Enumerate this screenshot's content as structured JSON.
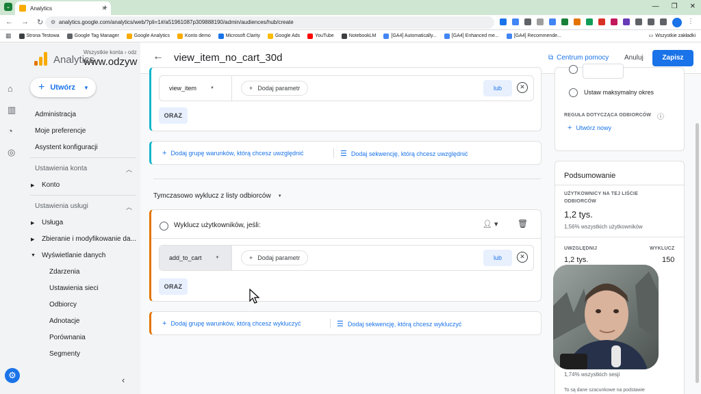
{
  "browser": {
    "tab_title": "Analytics",
    "url": "analytics.google.com/analytics/web/?pli=1#/a51961087p309888190/admin/audiences/hub/create",
    "bookmarks": [
      {
        "label": "Strona Testowa",
        "color": "#3c4043"
      },
      {
        "label": "Google Tag Manager",
        "color": "#5f6368"
      },
      {
        "label": "Google Analytics",
        "color": "#f9ab00"
      },
      {
        "label": "Konto demo",
        "color": "#f9ab00"
      },
      {
        "label": "Microsoft Clarity",
        "color": "#1a73e8"
      },
      {
        "label": "Google Ads",
        "color": "#fbbc04"
      },
      {
        "label": "YouTube",
        "color": "#ff0000"
      },
      {
        "label": "NotebookLM",
        "color": "#3c4043"
      },
      {
        "label": "[GA4] Automatically...",
        "color": "#4285f4"
      },
      {
        "label": "[GA4] Enhanced me...",
        "color": "#4285f4"
      },
      {
        "label": "[GA4] Recommende...",
        "color": "#4285f4"
      }
    ],
    "all_bookmarks_label": "Wszystkie zakładki"
  },
  "app": {
    "name": "Analytics",
    "account_breadcrumb": "Wszystkie konta › odz",
    "account_name": "www.odzyw",
    "create_button": "Utwórz",
    "accent": "#1a73e8"
  },
  "nav": {
    "top_items": [
      "Administracja",
      "Moje preferencje",
      "Asystent konfiguracji"
    ],
    "section_account": "Ustawienia konta",
    "account_items": [
      "Konto"
    ],
    "section_property": "Ustawienia usługi",
    "property_items": [
      "Usługa",
      "Zbieranie i modyfikowanie da...",
      "Wyświetlanie danych"
    ],
    "display_sub_items": [
      "Zdarzenia",
      "Ustawienia sieci",
      "Odbiorcy",
      "Adnotacje",
      "Porównania",
      "Segmenty"
    ]
  },
  "panel": {
    "title": "view_item_no_cart_30d",
    "help_label": "Centrum pomocy",
    "cancel_label": "Anuluj",
    "save_label": "Zapisz"
  },
  "include": {
    "event": "view_item",
    "add_param": "Dodaj parametr",
    "or_label": "lub",
    "and_label": "ORAZ",
    "add_group": "Dodaj grupę warunków, którą chcesz uwzględnić",
    "add_sequence": "Dodaj sekwencję, którą chcesz uwzględnić"
  },
  "exclude": {
    "heading": "Tymczasowo wyklucz z listy odbiorców",
    "title": "Wyklucz użytkowników, jeśli:",
    "event": "add_to_cart",
    "add_param": "Dodaj parametr",
    "or_label": "lub",
    "and_label": "ORAZ",
    "add_group": "Dodaj grupę warunków, którą chcesz wykluczyć",
    "add_sequence": "Dodaj sekwencję, którą chcesz wykluczyć"
  },
  "side": {
    "max_duration": "Ustaw maksymalny okres",
    "trigger_label": "REGUŁA DOTYCZĄCA ODBIORCÓW",
    "create_new": "Utwórz nowy",
    "summary_title": "Podsumowanie",
    "users_label_1": "UŻYTKOWNICY NA TEJ LIŚCIE",
    "users_label_2": "ODBIORCÓW",
    "users_value": "1,2 tys.",
    "users_pct": "1,56% wszystkich użytkowników",
    "include_label": "UWZGLĘDNIJ",
    "exclude_label": "WYKLUCZ",
    "include_value": "1,2 tys.",
    "exclude_value": "150",
    "sessions_pct": "1,74% wszystkich sesji",
    "footnote": "To są dane szacunkowe na podstawie"
  }
}
